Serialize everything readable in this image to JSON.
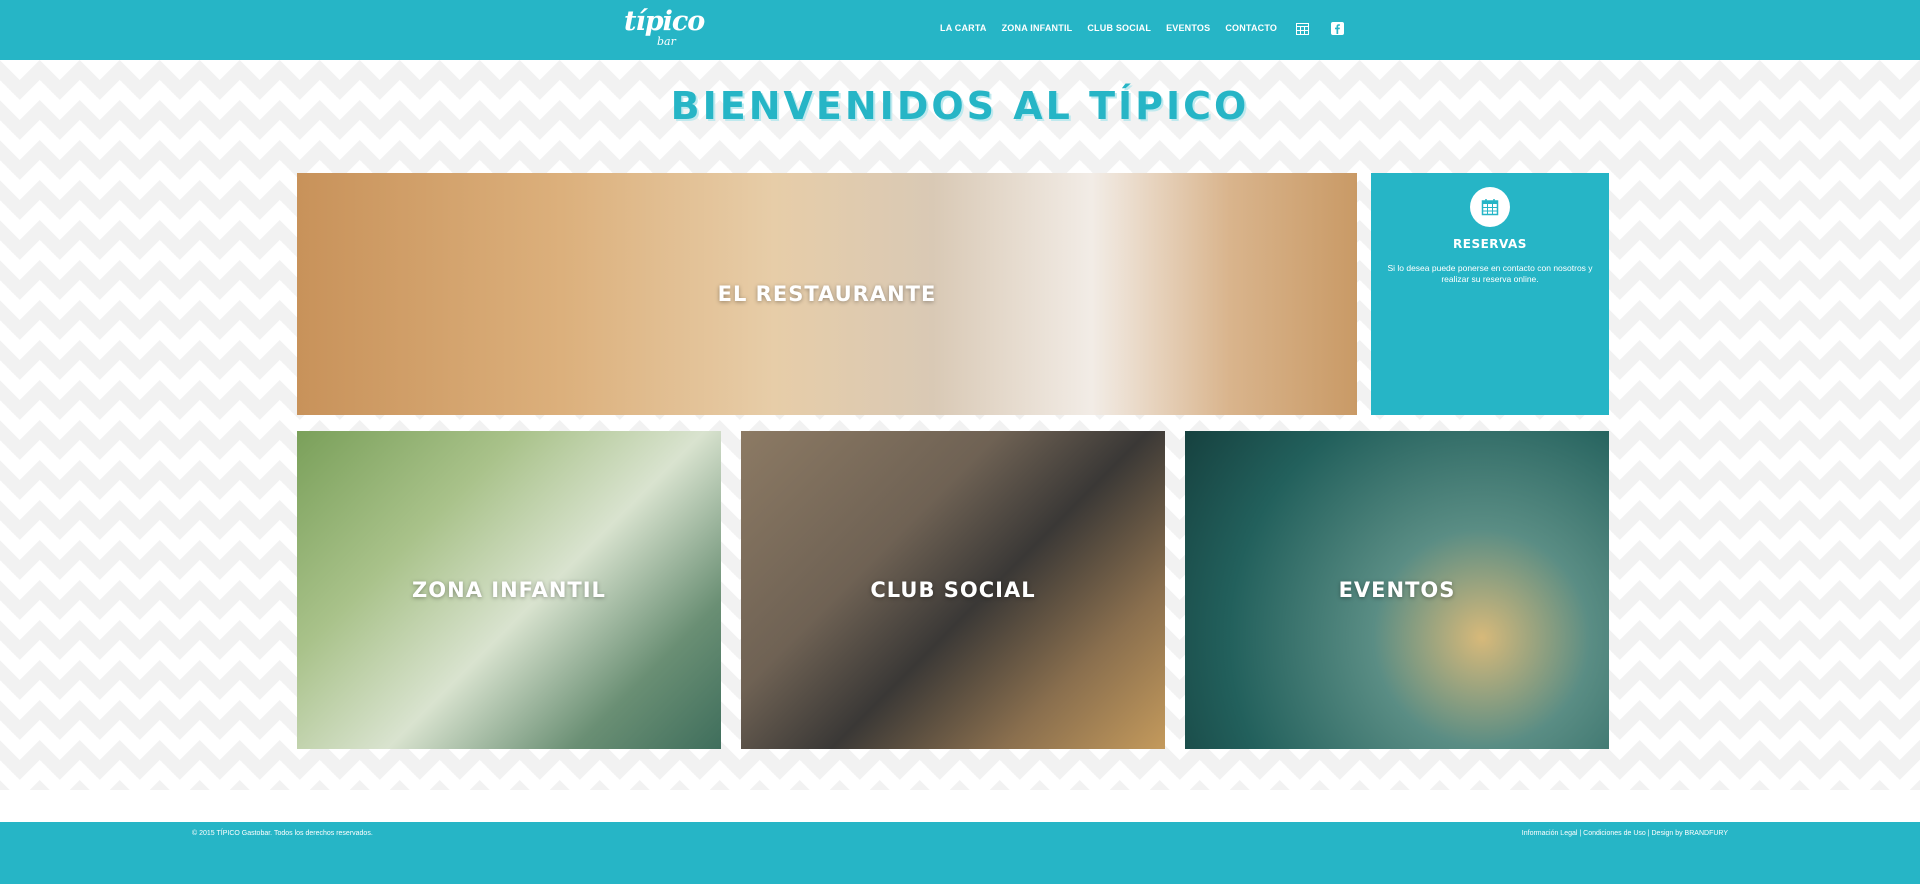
{
  "header": {
    "logo_main": "típico",
    "logo_sub": "bar",
    "nav": [
      "LA CARTA",
      "ZONA INFANTIL",
      "CLUB SOCIAL",
      "EVENTOS",
      "CONTACTO"
    ]
  },
  "page": {
    "title": "BIENVENIDOS AL TÍPICO"
  },
  "tiles": {
    "restaurante": "EL RESTAURANTE",
    "zona_infantil": "ZONA INFANTIL",
    "club_social": "CLUB SOCIAL",
    "eventos": "EVENTOS"
  },
  "reservas": {
    "title": "RESERVAS",
    "text": "Si lo desea puede ponerse en contacto con nosotros y realizar su reserva online."
  },
  "footer": {
    "copyright": "© 2015 TÍPICO Gastobar. Todos los derechos reservados.",
    "legal": "Información Legal | Condiciones de Uso | Design by BRANDFURY"
  },
  "colors": {
    "accent": "#26b5c6"
  },
  "icons": {
    "nav_calendar": "calendar-icon",
    "nav_facebook": "facebook-icon",
    "reservas": "calendar-icon"
  }
}
